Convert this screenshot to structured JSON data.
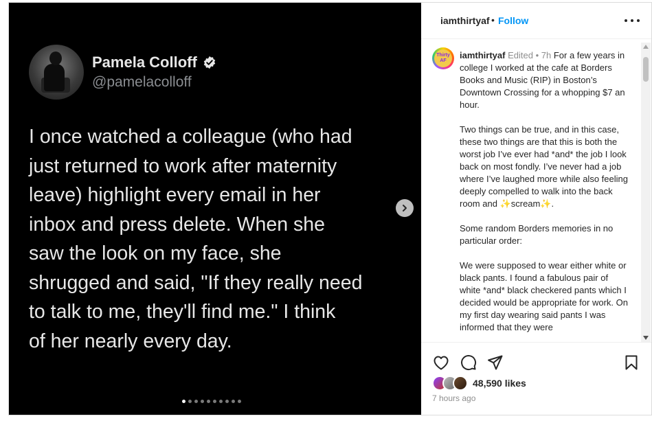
{
  "post": {
    "tweet": {
      "name": "Pamela Colloff",
      "handle": "@pamelacolloff",
      "text": "I once watched a colleague (who had\njust returned to work after maternity\nleave) highlight every email in her\ninbox and press delete. When she\nsaw the look on my face, she\nshrugged and said, \"If they really need\nto talk to me, they'll find me.\" I think\nof her nearly every day."
    },
    "carousel": {
      "total_slides": 10,
      "current_slide": 1
    }
  },
  "header": {
    "username": "iamthirtyaf",
    "separator": "•",
    "follow_label": "Follow"
  },
  "caption": {
    "avatar_text": "Thirty AF",
    "username": "iamthirtyaf",
    "meta": "Edited • 7h",
    "paragraphs": [
      "For a few years in college I worked at the cafe at Borders Books and Music (RIP) in Boston’s Downtown Crossing for a whopping $7 an hour.",
      "Two things can be true, and in this case, these two things are that this is both the worst job I’ve ever had *and* the job I look back on most fondly. I’ve never had a job where I’ve laughed more while also feeling deeply compelled to walk into the back room and",
      "Some random Borders memories in no particular order:",
      "We were supposed to wear either white or black pants. I found a fabulous pair of white *and* black checkered pants which I decided would be appropriate for work. On my first day wearing said pants I was informed that they were"
    ],
    "sparkle": "✨",
    "scream_word": "scream",
    "period": "."
  },
  "actions": {
    "likes": "48,590 likes",
    "time_ago": "7 hours ago"
  },
  "colors": {
    "accent": "#0095f6",
    "text": "#262626",
    "muted": "#8e8e8e",
    "tweet_bg": "#000000"
  }
}
